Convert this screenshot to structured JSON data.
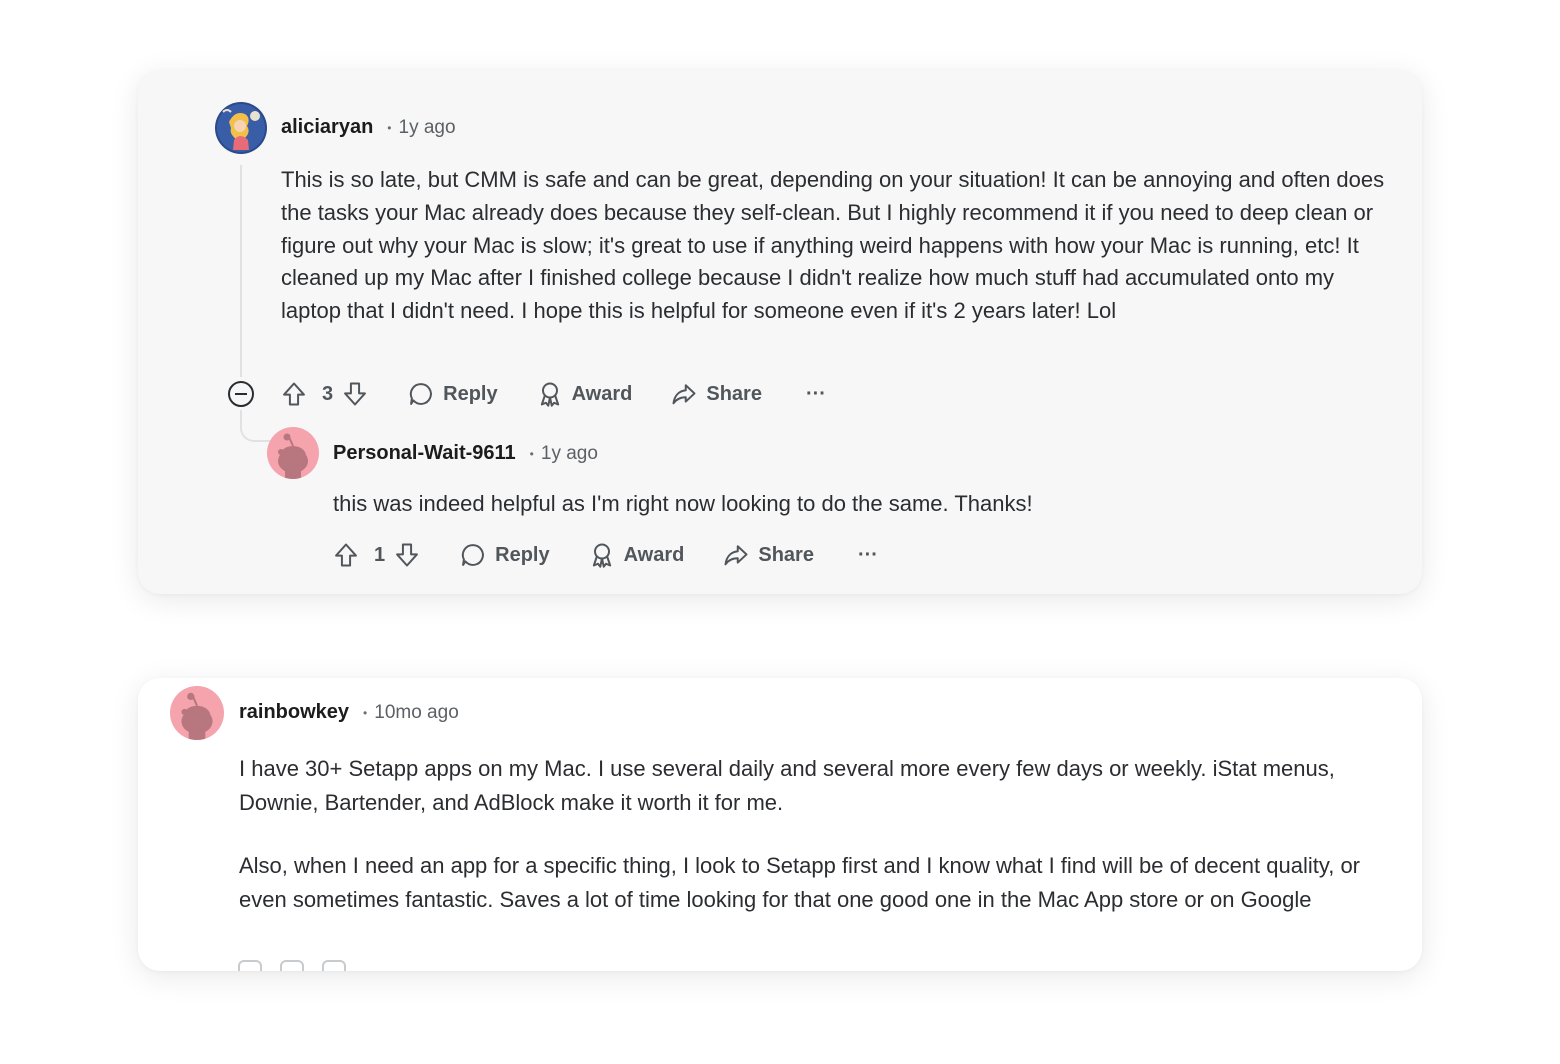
{
  "comments": [
    {
      "username": "aliciaryan",
      "time": "1y ago",
      "paragraphs": [
        "This is so late, but CMM is safe and can be great, depending on your situation! It can be annoying and often does the tasks your Mac already does because they self-clean. But I highly recommend it if you need to deep clean or figure out why your Mac is slow; it's great to use if anything weird happens with how your Mac is running, etc! It cleaned up my Mac after I finished college because I didn't realize how much stuff had accumulated onto my laptop that I didn't need. I hope this is helpful for someone even if it's 2 years later! Lol"
      ],
      "votes": "3",
      "actions": {
        "reply": "Reply",
        "award": "Award",
        "share": "Share",
        "more": "···"
      },
      "replies": [
        {
          "username": "Personal-Wait-9611",
          "time": "1y ago",
          "text": "this was indeed helpful as I'm right now looking to do the same. Thanks!",
          "votes": "1",
          "actions": {
            "reply": "Reply",
            "award": "Award",
            "share": "Share",
            "more": "···"
          }
        }
      ]
    },
    {
      "username": "rainbowkey",
      "time": "10mo ago",
      "paragraphs": [
        "I have 30+ Setapp apps on my Mac. I use several daily and several more every few days or weekly. iStat menus, Downie, Bartender, and AdBlock make it worth it for me.",
        "Also, when I need an app for a specific thing, I look to Setapp first and I know what I find will be of decent quality, or even sometimes fantastic. Saves a lot of time looking for that one good one in the Mac App store or on Google"
      ]
    }
  ],
  "colors": {
    "default_avatar_bg": "#f5a3ad",
    "snoo": "#b8777f",
    "card1_bg": "#f7f7f8"
  }
}
